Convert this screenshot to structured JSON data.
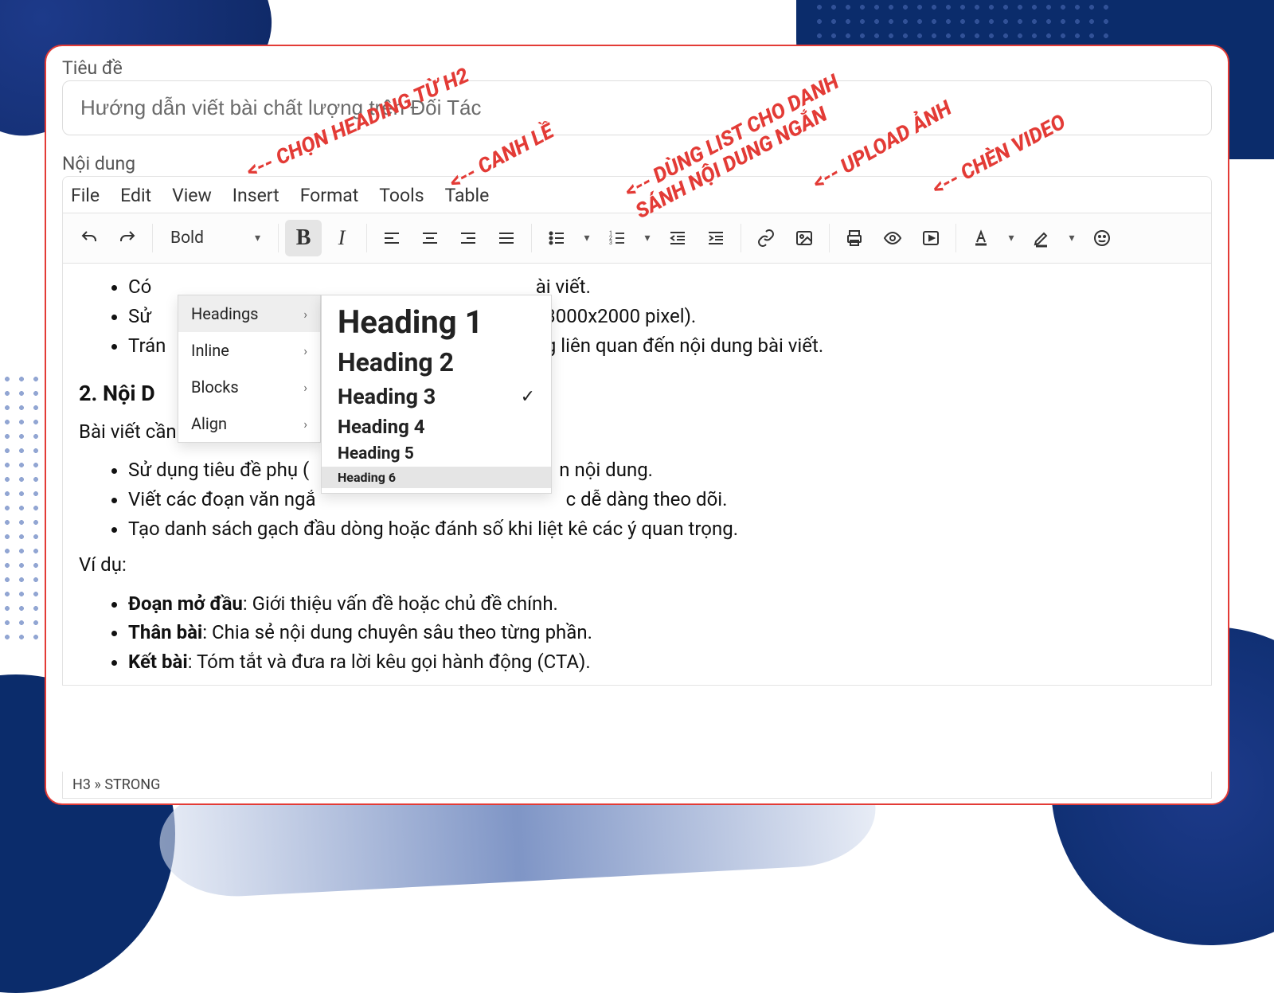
{
  "labels": {
    "title": "Tiêu đề",
    "content": "Nội dung"
  },
  "title_input": {
    "value": "Hướng dẫn viết bài chất lượng trên Đối Tác"
  },
  "menubar": {
    "file": "File",
    "edit": "Edit",
    "view": "View",
    "insert": "Insert",
    "format": "Format",
    "tools": "Tools",
    "table": "Table"
  },
  "toolbar": {
    "font_name": "Bold"
  },
  "dropdown_categories": {
    "headings": "Headings",
    "inline": "Inline",
    "blocks": "Blocks",
    "align": "Align"
  },
  "heading_options": {
    "h1": "Heading 1",
    "h2": "Heading 2",
    "h3": "Heading 3",
    "h4": "Heading 4",
    "h5": "Heading 5",
    "h6": "Heading 6"
  },
  "content": {
    "bullets_top": {
      "b1_prefix": "Có ",
      "b1_suffix": "ài viết.",
      "b2_prefix": "Sử ",
      "b2_mid": ": 3000x2000 pixel).",
      "b3_prefix": "Trán",
      "b3_suffix": "g liên quan đến nội dung bài viết."
    },
    "section2_title": "2. Nội D",
    "section2_para": "Bài viết cần dễ đọc và liền m",
    "bullets_mid": {
      "b1": "Sử dụng tiêu đề phụ (",
      "b1_suffix": "n nội dung.",
      "b2": "Viết các đoạn văn ngắ",
      "b2_suffix": "c dễ dàng theo dõi.",
      "b3": "Tạo danh sách gạch đầu dòng hoặc đánh số khi liệt kê các ý quan trọng."
    },
    "example_label": "Ví dụ:",
    "bullets_ex": {
      "b1_strong": "Đoạn mở đầu",
      "b1_rest": ": Giới thiệu vấn đề hoặc chủ đề chính.",
      "b2_strong": "Thân bài",
      "b2_rest": ": Chia sẻ nội dung chuyên sâu theo từng phần.",
      "b3_strong": "Kết bài",
      "b3_rest": ": Tóm tắt và đưa ra lời kêu gọi hành động (CTA)."
    }
  },
  "statusbar": {
    "path": "H3 » STRONG"
  },
  "annotations": {
    "heading": "<-- CHỌN HEADING TỪ H2",
    "align": "<-- CANH LỀ",
    "list_line1": "<-- DÙNG LIST CHO DANH",
    "list_line2": "SÁNH NỘI DUNG NGẮN",
    "upload": "<-- UPLOAD ẢNH",
    "video": "<-- CHÈN VIDEO"
  }
}
